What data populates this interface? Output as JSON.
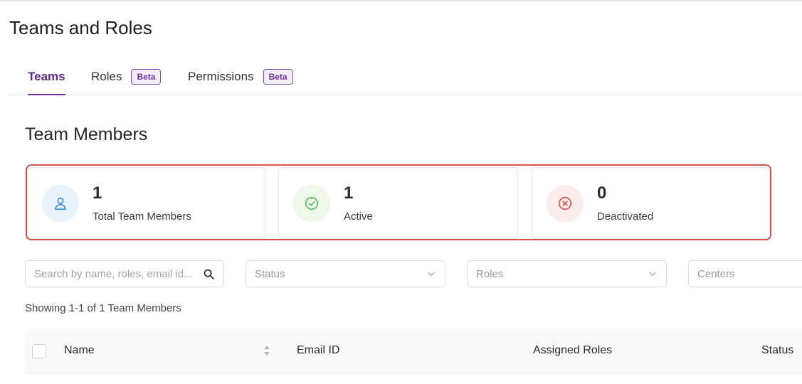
{
  "page": {
    "title": "Teams and Roles"
  },
  "tabs": [
    {
      "label": "Teams",
      "active": true
    },
    {
      "label": "Roles",
      "badge": "Beta"
    },
    {
      "label": "Permissions",
      "badge": "Beta"
    }
  ],
  "section": {
    "title": "Team Members"
  },
  "stats": [
    {
      "value": "1",
      "label": "Total Team Members",
      "icon": "user-icon",
      "color": "#3a8fd6",
      "bg": "#e8f3fc"
    },
    {
      "value": "1",
      "label": "Active",
      "icon": "check-circle-icon",
      "color": "#5cb85c",
      "bg": "#eef8e8"
    },
    {
      "value": "0",
      "label": "Deactivated",
      "icon": "x-circle-icon",
      "color": "#d9534f",
      "bg": "#fcebeb"
    }
  ],
  "filters": {
    "search_placeholder": "Search by name, roles, email id...",
    "status_placeholder": "Status",
    "roles_placeholder": "Roles",
    "centers_placeholder": "Centers"
  },
  "results": {
    "showing_text": "Showing 1-1 of 1 Team Members"
  },
  "table": {
    "columns": [
      "Name",
      "Email ID",
      "Assigned Roles",
      "Status"
    ]
  },
  "colors": {
    "accent": "#6a33a0",
    "highlight_border": "#d9534f"
  }
}
